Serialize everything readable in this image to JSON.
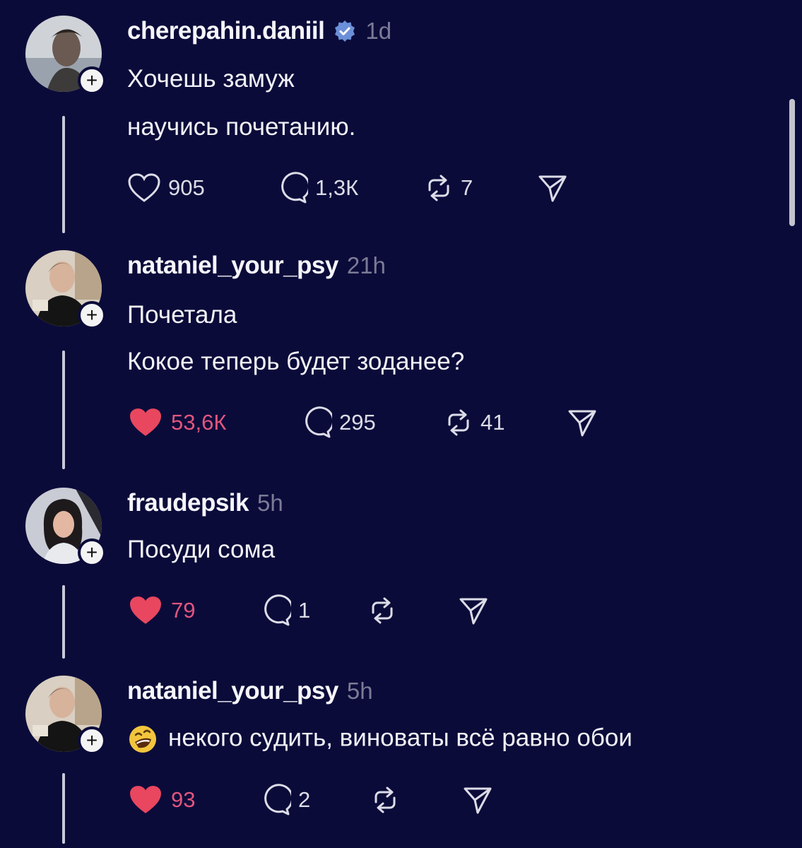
{
  "posts": [
    {
      "username": "cherepahin.daniil",
      "verified": true,
      "time": "1d",
      "lines": [
        "Хочешь замуж",
        "научись почетанию."
      ],
      "likes": "905",
      "liked": false,
      "comments": "1,3К",
      "reposts": "7"
    },
    {
      "username": "nataniel_your_psy",
      "verified": false,
      "time": "21h",
      "lines": [
        "Почетала",
        "Кокое теперь будет зоданее?"
      ],
      "likes": "53,6К",
      "liked": true,
      "comments": "295",
      "reposts": "41"
    },
    {
      "username": "fraudepsik",
      "verified": false,
      "time": "5h",
      "lines": [
        "Посуди сома"
      ],
      "likes": "79",
      "liked": true,
      "comments": "1",
      "reposts": ""
    },
    {
      "username": "nataniel_your_psy",
      "verified": false,
      "time": "5h",
      "lines": [
        "некого судить, виноваты всё равно обои"
      ],
      "emoji": "rofl-emoji",
      "likes": "93",
      "liked": true,
      "comments": "2",
      "reposts": ""
    }
  ],
  "colors": {
    "background": "#0b0b3a",
    "like_active": "#e8475f",
    "verified": "#6b8fd8",
    "muted": "#7b7b96"
  },
  "icons": {
    "follow": "plus-icon",
    "like": "heart-icon",
    "comment": "comment-icon",
    "repost": "repost-icon",
    "share": "send-icon",
    "verified": "verified-badge-icon"
  }
}
